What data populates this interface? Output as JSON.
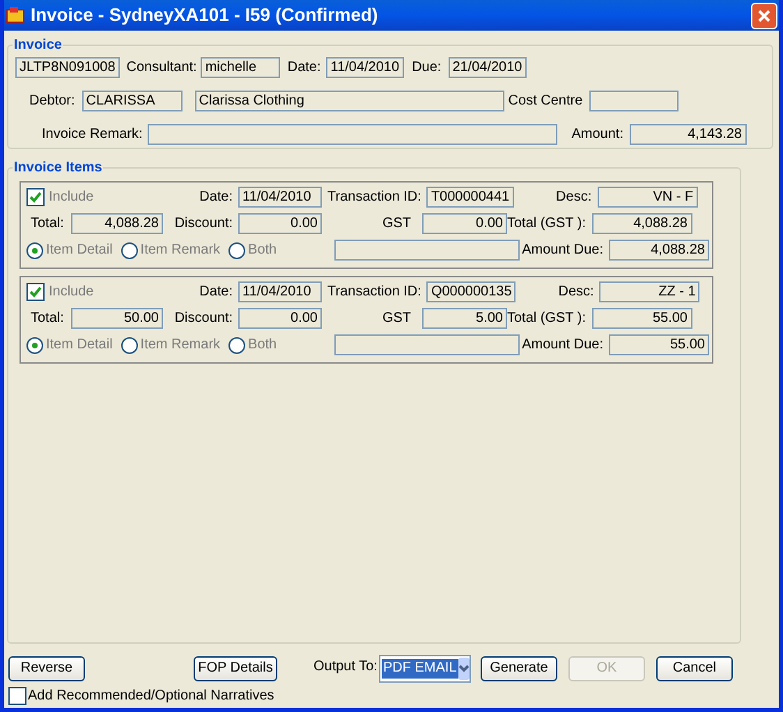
{
  "window": {
    "title": "Invoice - SydneyXA101 - I59 (Confirmed)"
  },
  "invoice": {
    "heading": "Invoice",
    "number": "JLTP8N091008",
    "consultant_label": "Consultant:",
    "consultant": "michelle",
    "date_label": "Date:",
    "date": "11/04/2010",
    "due_label": "Due:",
    "due": "21/04/2010",
    "debtor_label": "Debtor:",
    "debtor_code": "CLARISSA",
    "debtor_name": "Clarissa Clothing",
    "cost_centre_label": "Cost Centre",
    "remark_label": "Invoice Remark:",
    "amount_label": "Amount:",
    "amount": "4,143.28"
  },
  "items_heading": "Invoice Items",
  "items": [
    {
      "include_label": "Include",
      "checked": true,
      "date_label": "Date:",
      "date": "11/04/2010",
      "transaction_label": "Transaction ID:",
      "transaction": "T000000441",
      "desc_label": "Desc:",
      "desc": "VN - F",
      "total_label": "Total:",
      "total": "4,088.28",
      "discount_label": "Discount:",
      "discount": "0.00",
      "gst_label": "GST",
      "gst": "0.00",
      "total_gst_label": "Total (GST ):",
      "total_gst": "4,088.28",
      "amount_due_label": "Amount Due:",
      "amount_due": "4,088.28",
      "radios": [
        {
          "label": "Item Detail",
          "selected": true
        },
        {
          "label": "Item Remark",
          "selected": false
        },
        {
          "label": "Both",
          "selected": false
        }
      ]
    },
    {
      "include_label": "Include",
      "checked": true,
      "date_label": "Date:",
      "date": "11/04/2010",
      "transaction_label": "Transaction ID:",
      "transaction": "Q000000135",
      "desc_label": "Desc:",
      "desc": "ZZ - 1",
      "total_label": "Total:",
      "total": "50.00",
      "discount_label": "Discount:",
      "discount": "0.00",
      "gst_label": "GST",
      "gst": "5.00",
      "total_gst_label": "Total (GST ):",
      "total_gst": "55.00",
      "amount_due_label": "Amount Due:",
      "amount_due": "55.00",
      "radios": [
        {
          "label": "Item Detail",
          "selected": true
        },
        {
          "label": "Item Remark",
          "selected": false
        },
        {
          "label": "Both",
          "selected": false
        }
      ]
    }
  ],
  "footer": {
    "reverse": {
      "label": "Reverse",
      "disabled": false
    },
    "fop": {
      "label": "FOP Details",
      "disabled": false
    },
    "output_label": "Output To:",
    "output_value": "PDF EMAIL",
    "buttons": [
      {
        "label": "Generate",
        "disabled": false
      },
      {
        "label": "OK",
        "disabled": true
      },
      {
        "label": "Cancel",
        "disabled": false
      }
    ],
    "narratives": {
      "label": "Add Recommended/Optional Narratives",
      "checked": false
    }
  }
}
